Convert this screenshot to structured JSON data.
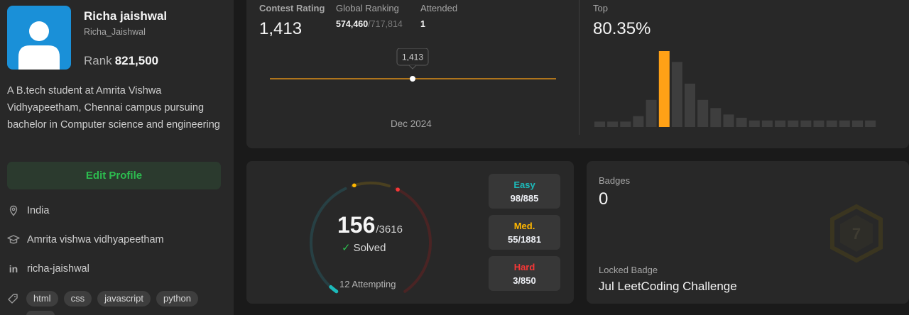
{
  "profile": {
    "name": "Richa jaishwal",
    "username": "Richa_Jaishwal",
    "rank_label": "Rank",
    "rank_value": "821,500",
    "bio": "A B.tech student at Amrita Vishwa Vidhyapeetham, Chennai campus pursuing bachelor in Computer science and engineering",
    "edit_label": "Edit Profile",
    "location": "India",
    "school": "Amrita vishwa vidhyapeetham",
    "linkedin": "richa-jaishwal",
    "skills": [
      "html",
      "css",
      "javascript",
      "python"
    ]
  },
  "contest": {
    "rating_label": "Contest Rating",
    "rating_value": "1,413",
    "global_label": "Global Ranking",
    "global_value": "574,460",
    "global_total": "/717,814",
    "attended_label": "Attended",
    "attended_value": "1",
    "tooltip": "1,413",
    "date_label": "Dec 2024",
    "top_label": "Top",
    "top_value": "80.35%"
  },
  "chart_data": {
    "type": "bar",
    "title": "",
    "highlight_index": 5,
    "values": [
      1,
      1,
      1,
      2,
      5,
      14,
      12,
      8,
      5,
      3.5,
      2.3,
      1.7,
      1.2,
      1.2,
      1.2,
      1.2,
      1.2,
      1.2,
      1.2,
      1.2,
      1.2,
      1.2
    ],
    "colors": {
      "bar": "#3e3e3e",
      "highlight": "#ffa116"
    }
  },
  "solved": {
    "count": "156",
    "total": "/3616",
    "check": "✓",
    "solved_label": "Solved",
    "attempting": "12 Attempting",
    "ring": {
      "easy": 98,
      "medium": 55,
      "hard": 3
    },
    "easy_label": "Easy",
    "easy_value": "98/885",
    "med_label": "Med.",
    "med_value": "55/1881",
    "hard_label": "Hard",
    "hard_value": "3/850",
    "colors": {
      "easy": "#1cbaba",
      "medium": "#ffb700",
      "hard": "#f63737"
    }
  },
  "badges": {
    "label": "Badges",
    "count": "0",
    "locked_label": "Locked Badge",
    "locked_name": "Jul LeetCoding Challenge",
    "badge_glyph": "7"
  }
}
